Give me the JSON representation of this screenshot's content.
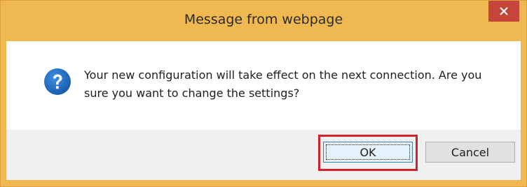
{
  "dialog": {
    "title": "Message from webpage",
    "close_icon": "close-icon",
    "message": "Your new configuration will take effect on the next connection. Are you sure you want to change the settings?",
    "icon": "question-icon",
    "buttons": {
      "ok_label": "OK",
      "cancel_label": "Cancel"
    }
  },
  "colors": {
    "titlebar": "#f0b850",
    "close_button": "#c7463c",
    "highlight": "#d1212d",
    "icon_blue": "#1e6fc7"
  }
}
